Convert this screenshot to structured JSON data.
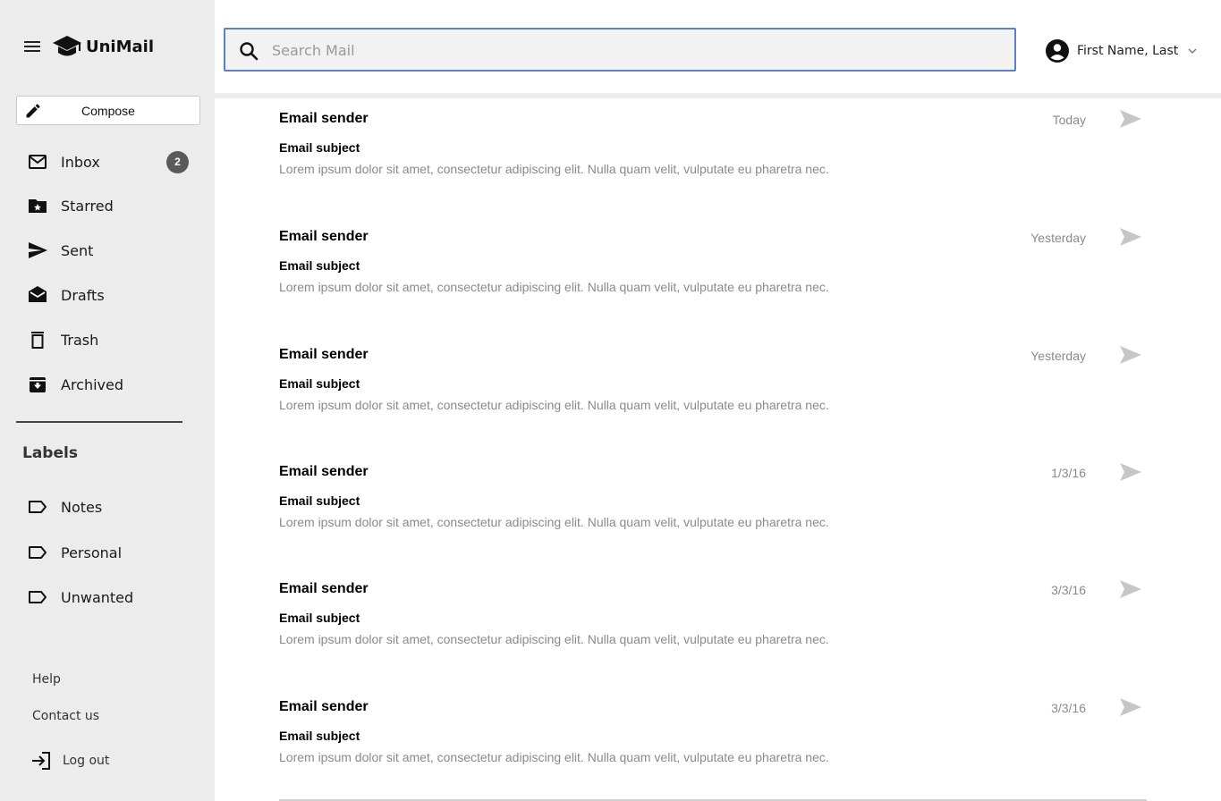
{
  "app": {
    "name": "UniMail"
  },
  "sidebar": {
    "compose_label": "Compose",
    "nav": [
      {
        "label": "Inbox",
        "icon": "mail-icon",
        "badge": "2"
      },
      {
        "label": "Starred",
        "icon": "starred-folder-icon"
      },
      {
        "label": "Sent",
        "icon": "send-icon"
      },
      {
        "label": "Drafts",
        "icon": "drafts-icon"
      },
      {
        "label": "Trash",
        "icon": "trash-icon"
      },
      {
        "label": "Archived",
        "icon": "archive-icon"
      }
    ],
    "labels_title": "Labels",
    "labels": [
      {
        "label": "Notes",
        "icon": "label-icon"
      },
      {
        "label": "Personal",
        "icon": "label-icon"
      },
      {
        "label": "Unwanted",
        "icon": "label-icon"
      }
    ],
    "footer": {
      "help": "Help",
      "contact": "Contact us",
      "logout": "Log out"
    }
  },
  "header": {
    "search_placeholder": "Search Mail",
    "search_value": "",
    "user_name": "First Name, Last"
  },
  "colors": {
    "sidebar_bg": "#ececec",
    "search_border": "#5b7fcb",
    "badge_bg": "#5a5a5a",
    "muted_text": "#8a8a8a"
  },
  "emails": [
    {
      "sender": "Email sender",
      "subject": "Email subject",
      "preview": "Lorem ipsum dolor sit amet, consectetur adipiscing elit. Nulla quam velit, vulputate eu pharetra nec.",
      "date": "Today"
    },
    {
      "sender": "Email sender",
      "subject": "Email subject",
      "preview": "Lorem ipsum dolor sit amet, consectetur adipiscing elit. Nulla quam velit, vulputate eu pharetra nec.",
      "date": "Yesterday"
    },
    {
      "sender": "Email sender",
      "subject": "Email subject",
      "preview": "Lorem ipsum dolor sit amet, consectetur adipiscing elit. Nulla quam velit, vulputate eu pharetra nec.",
      "date": "Yesterday"
    },
    {
      "sender": "Email sender",
      "subject": "Email subject",
      "preview": "Lorem ipsum dolor sit amet, consectetur adipiscing elit. Nulla quam velit, vulputate eu pharetra nec.",
      "date": "1/3/16"
    },
    {
      "sender": "Email sender",
      "subject": "Email subject",
      "preview": "Lorem ipsum dolor sit amet, consectetur adipiscing elit. Nulla quam velit, vulputate eu pharetra nec.",
      "date": "3/3/16"
    },
    {
      "sender": "Email sender",
      "subject": "Email subject",
      "preview": "Lorem ipsum dolor sit amet, consectetur adipiscing elit. Nulla quam velit, vulputate eu pharetra nec.",
      "date": "3/3/16"
    }
  ]
}
